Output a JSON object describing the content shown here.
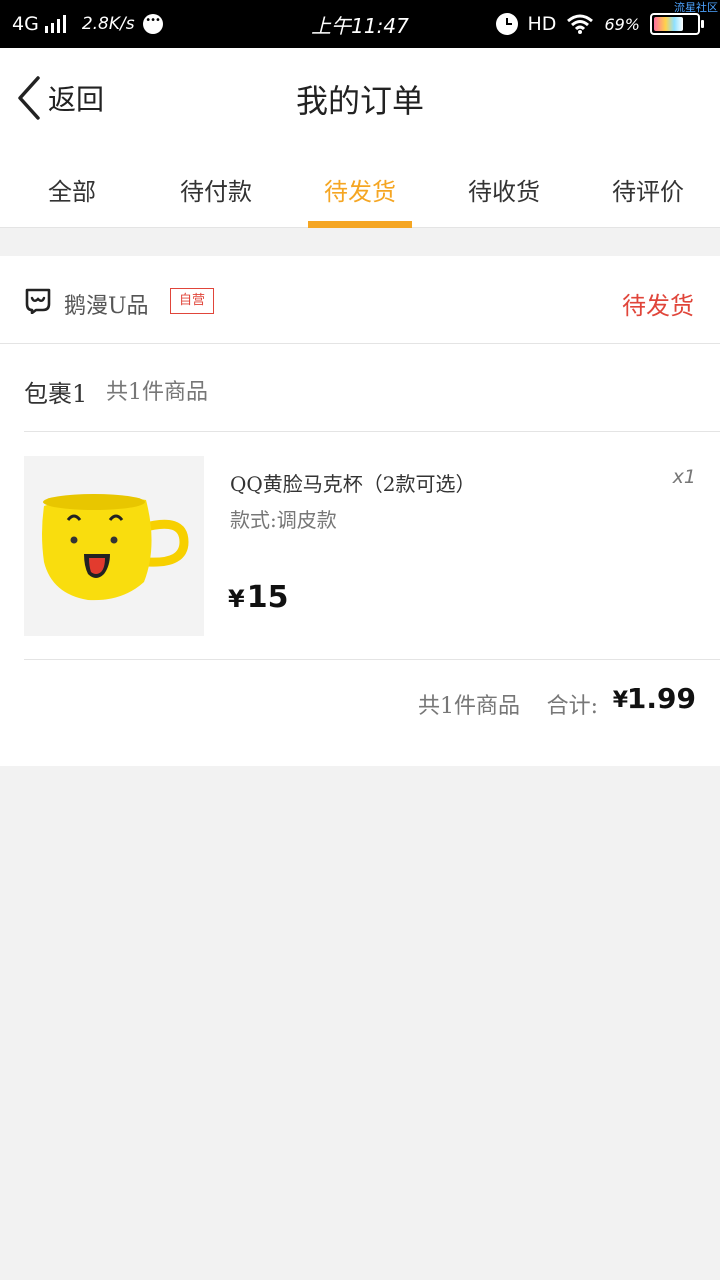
{
  "status_bar": {
    "network": "4G",
    "speed": "2.8K/s",
    "time": "上午11:47",
    "hd": "HD",
    "battery": "69%",
    "watermark": "流星社区"
  },
  "header": {
    "back_label": "返回",
    "title": "我的订单"
  },
  "tabs": [
    {
      "label": "全部"
    },
    {
      "label": "待付款"
    },
    {
      "label": "待发货"
    },
    {
      "label": "待收货"
    },
    {
      "label": "待评价"
    }
  ],
  "active_tab": "待发货",
  "order": {
    "shop_name": "鹅漫U品",
    "shop_tag": "自营",
    "status": "待发货",
    "package_label": "包裹1",
    "package_count": "共1件商品",
    "item": {
      "name": "QQ黄脸马克杯（2款可选）",
      "spec": "款式:调皮款",
      "qty": "x1",
      "currency": "¥",
      "price": "15",
      "image": "yellow-emoji-mug-icon"
    },
    "total_count": "共1件商品",
    "total_label": "合计:",
    "total_currency": "¥",
    "total_amount": "1.99"
  },
  "colors": {
    "accent": "#f5a623",
    "status_red": "#e0453a"
  }
}
